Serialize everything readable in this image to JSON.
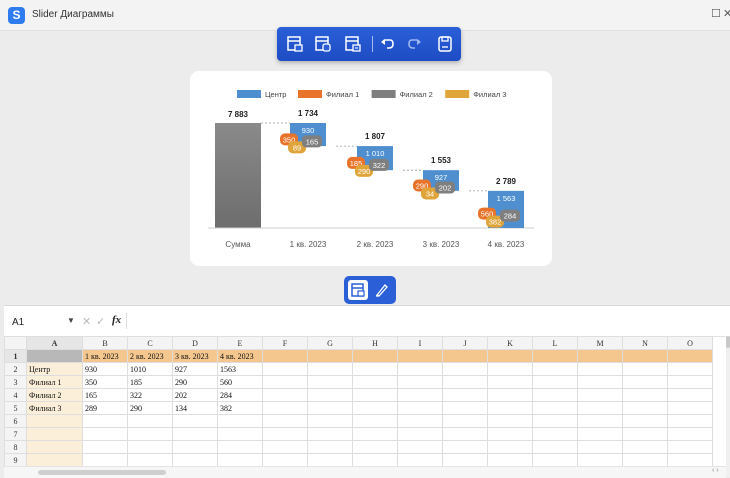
{
  "window": {
    "title": "Slider Диаграммы",
    "app_icon_letter": "S"
  },
  "toolbar": {
    "icons": [
      "insert-table-icon",
      "table-layout-icon",
      "table-settings-icon",
      "undo-icon",
      "redo-icon",
      "save-icon"
    ]
  },
  "chart_data": {
    "type": "waterfall",
    "title": "",
    "categories": [
      "Сумма",
      "1 кв. 2023",
      "2 кв. 2023",
      "3 кв. 2023",
      "4 кв. 2023"
    ],
    "total": {
      "label": "7 883",
      "value": 7883
    },
    "totals_labels": [
      "1 734",
      "1 807",
      "1 553",
      "2 789"
    ],
    "series": [
      {
        "name": "Центр",
        "color": "#4f8fcf",
        "values": [
          930,
          1010,
          927,
          1563
        ]
      },
      {
        "name": "Филиал 1",
        "color": "#e8732a",
        "values": [
          350,
          185,
          290,
          560
        ]
      },
      {
        "name": "Филиал 2",
        "color": "#7f7f7f",
        "values": [
          165,
          322,
          202,
          284
        ]
      },
      {
        "name": "Филиал 3",
        "color": "#e0a53a",
        "values": [
          289,
          290,
          134,
          382
        ]
      }
    ],
    "segment_labels": [
      [
        "930",
        "350",
        "165",
        "89"
      ],
      [
        "1 010",
        "185",
        "322",
        "290"
      ],
      [
        "927",
        "290",
        "202",
        "34"
      ],
      [
        "1 563",
        "560",
        "284",
        "382"
      ]
    ],
    "legend_position": "top"
  },
  "sheet": {
    "cell_ref": "A1",
    "fx_label": "fx",
    "columns": [
      "A",
      "B",
      "C",
      "D",
      "E",
      "F",
      "G",
      "H",
      "I",
      "J",
      "K",
      "L",
      "M",
      "N",
      "O"
    ],
    "rows": [
      [
        "",
        "1 кв. 2023",
        "2 кв. 2023",
        "3 кв. 2023",
        "4 кв. 2023"
      ],
      [
        "Центр",
        "930",
        "1010",
        "927",
        "1563"
      ],
      [
        "Филиал 1",
        "350",
        "185",
        "290",
        "560"
      ],
      [
        "Филиал 2",
        "165",
        "322",
        "202",
        "284"
      ],
      [
        "Филиал 3",
        "289",
        "290",
        "134",
        "382"
      ],
      [],
      [],
      [],
      [],
      []
    ]
  }
}
